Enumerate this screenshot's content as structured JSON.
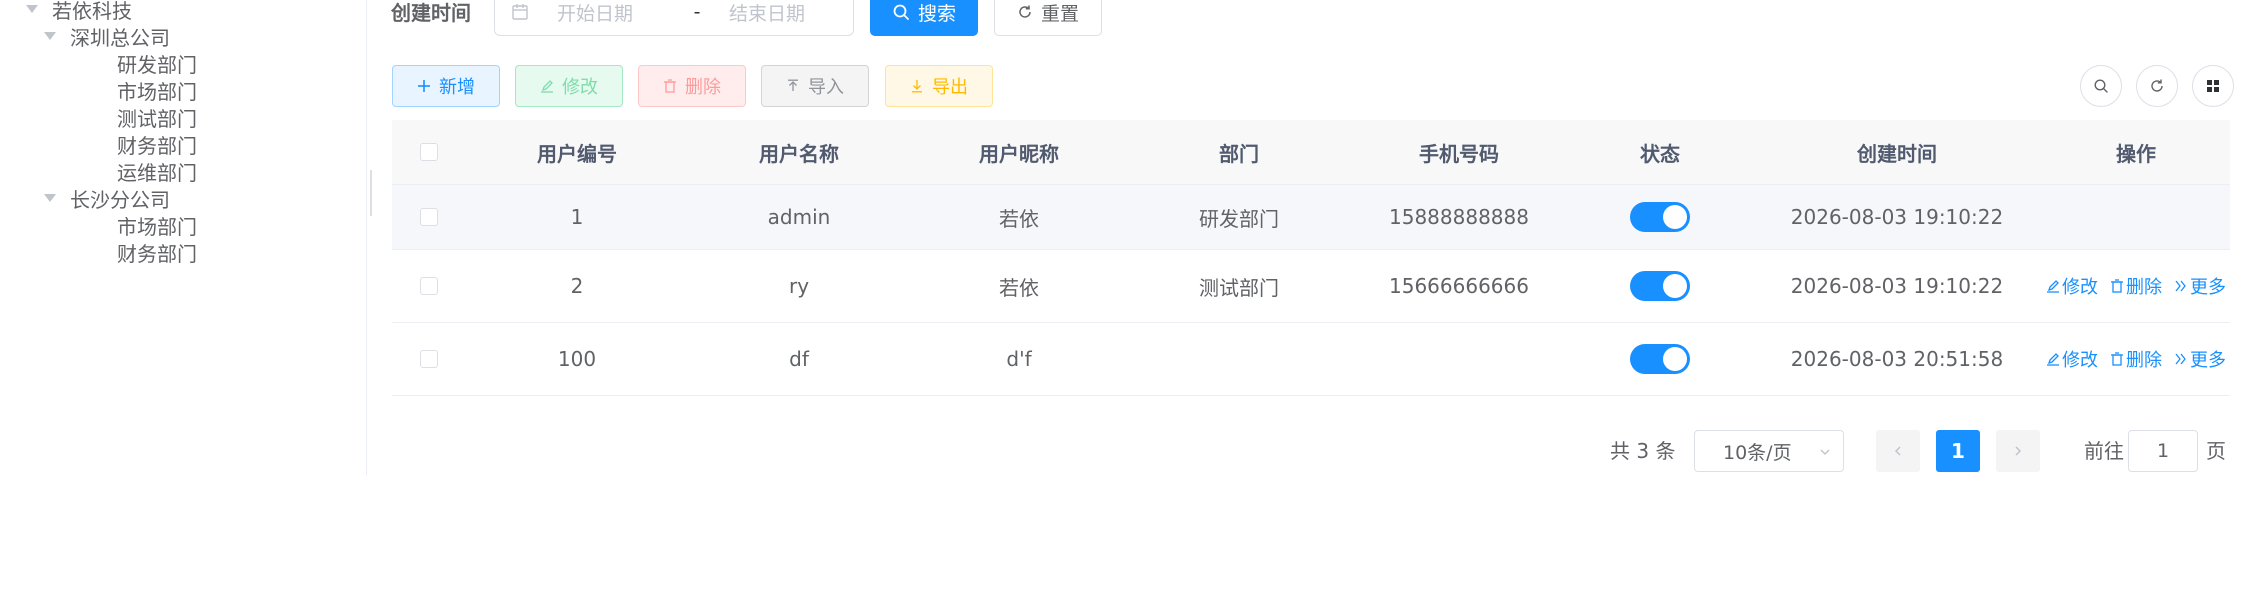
{
  "tree": {
    "root": "若依科技",
    "shenzhen": {
      "label": "深圳总公司",
      "children": [
        "研发部门",
        "市场部门",
        "测试部门",
        "财务部门",
        "运维部门"
      ]
    },
    "changsha": {
      "label": "长沙分公司",
      "children": [
        "市场部门",
        "财务部门"
      ]
    }
  },
  "search": {
    "label": "创建时间",
    "start_placeholder": "开始日期",
    "separator": "-",
    "end_placeholder": "结束日期",
    "search_button": "搜索",
    "reset_button": "重置"
  },
  "toolbar": {
    "add": "新增",
    "edit": "修改",
    "delete": "删除",
    "import": "导入",
    "export": "导出"
  },
  "table": {
    "columns": [
      "用户编号",
      "用户名称",
      "用户昵称",
      "部门",
      "手机号码",
      "状态",
      "创建时间",
      "操作"
    ],
    "rows": [
      {
        "id": "1",
        "username": "admin",
        "nickname": "若依",
        "dept": "研发部门",
        "phone": "15888888888",
        "status_on": true,
        "created": "2026-08-03 19:10:22",
        "ops": []
      },
      {
        "id": "2",
        "username": "ry",
        "nickname": "若依",
        "dept": "测试部门",
        "phone": "15666666666",
        "status_on": true,
        "created": "2026-08-03 19:10:22",
        "ops": [
          "修改",
          "删除",
          "更多"
        ]
      },
      {
        "id": "100",
        "username": "df",
        "nickname": "d'f",
        "dept": "",
        "phone": "",
        "status_on": true,
        "created": "2026-08-03 20:51:58",
        "ops": [
          "修改",
          "删除",
          "更多"
        ]
      }
    ]
  },
  "pagination": {
    "total": "共 3 条",
    "page_size": "10条/页",
    "current_page": "1",
    "goto_label": "前往",
    "goto_value": "1",
    "page_unit": "页"
  },
  "colors": {
    "primary": "#1890ff",
    "success": "#13ce66",
    "danger": "#ff4949",
    "info": "#909399",
    "warning": "#ffba00"
  }
}
